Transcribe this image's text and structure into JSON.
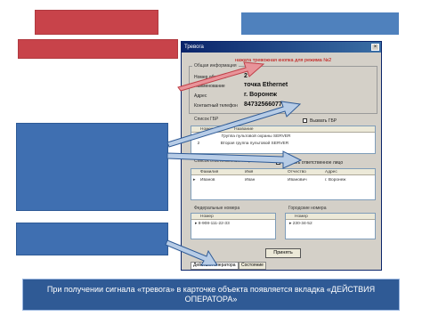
{
  "window": {
    "title": "Тревога",
    "alert_text": "нажата тревожная кнопка для режима №2",
    "general_info": {
      "group_label": "Общая информация",
      "number_label": "Номер объекта",
      "number_value": "2",
      "name_label": "Наименование",
      "name_value": "точка Ethernet",
      "address_label": "Адрес",
      "address_value": "г. Воронеж",
      "phone_label": "Контактный телефон",
      "phone_value": "84732566077"
    },
    "gbr": {
      "group_label": "Список ГБР",
      "checkbox_label": "Вызвать ГБР",
      "columns": [
        "Номер",
        "Название"
      ],
      "rows": [
        [
          "1",
          "Группа пультовой охраны SERVER"
        ],
        [
          "2",
          "Вторая группа пультовой SERVER"
        ]
      ]
    },
    "responsible": {
      "group_label": "Список ответственных лиц",
      "checkbox_label": "Вызвать ответственное лицо",
      "columns": [
        "Фамилия",
        "Имя",
        "Отчество",
        "Адрес"
      ],
      "rows": [
        [
          "Иванов",
          "Иван",
          "Иванович",
          "г. Воронеж"
        ]
      ]
    },
    "home_numbers": {
      "group_label": "Федеральные номера",
      "column": "Номер",
      "rows": [
        "8-908-111-22-33"
      ]
    },
    "city_numbers": {
      "group_label": "Городские номера",
      "column": "Номер",
      "rows": [
        "230-34-52"
      ]
    },
    "accept_button": "Принять",
    "tabs": [
      "Действия оператора",
      "Состояние"
    ]
  },
  "caption": "При получении сигнала «тревога» в карточке объекта  появляется вкладка «ДЕЙСТВИЯ ОПЕРАТОРА»"
}
